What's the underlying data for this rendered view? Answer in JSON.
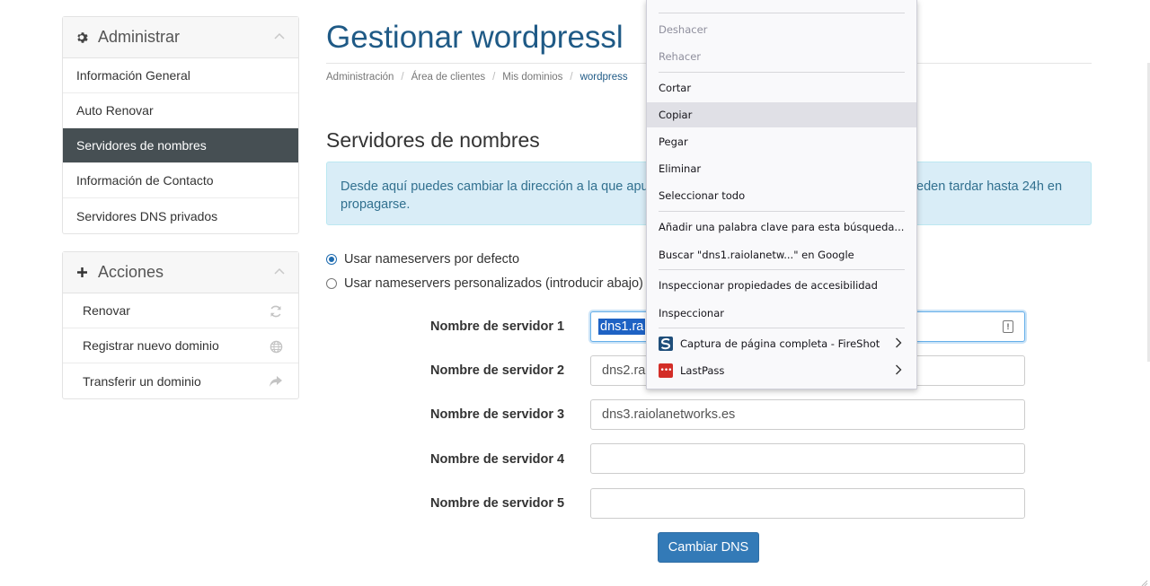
{
  "sidebar": {
    "admin_panel": {
      "title": "Administrar",
      "items": [
        {
          "label": "Información General"
        },
        {
          "label": "Auto Renovar"
        },
        {
          "label": "Servidores de nombres"
        },
        {
          "label": "Información de Contacto"
        },
        {
          "label": "Servidores DNS privados"
        }
      ]
    },
    "actions_panel": {
      "title": "Acciones",
      "items": [
        {
          "label": "Renovar",
          "icon": "refresh-icon"
        },
        {
          "label": "Registrar nuevo dominio",
          "icon": "globe-icon"
        },
        {
          "label": "Transferir un dominio",
          "icon": "share-arrow-icon"
        }
      ]
    }
  },
  "main": {
    "page_title": "Gestionar wordpressl",
    "breadcrumb": [
      "Administración",
      "Área de clientes",
      "Mis dominios",
      "wordpress"
    ],
    "section_title": "Servidores de nombres",
    "alert": {
      "left_text": "Desde aquí puedes cambiar la dirección a la que apu",
      "right_text": "eden tardar hasta 24h en",
      "second_line": "propagarse."
    },
    "radio_default": "Usar nameservers por defecto",
    "radio_custom": "Usar nameservers personalizados (introducir abajo)",
    "fields": [
      {
        "label": "Nombre de servidor 1",
        "value": "dns1.ra"
      },
      {
        "label": "Nombre de servidor 2",
        "value": "dns2.ra"
      },
      {
        "label": "Nombre de servidor 3",
        "value": "dns3.raiolanetworks.es"
      },
      {
        "label": "Nombre de servidor 4",
        "value": ""
      },
      {
        "label": "Nombre de servidor 5",
        "value": ""
      }
    ],
    "submit_label": "Cambiar DNS"
  },
  "context_menu": {
    "undo": "Deshacer",
    "redo": "Rehacer",
    "cut": "Cortar",
    "copy": "Copiar",
    "paste": "Pegar",
    "delete": "Eliminar",
    "select_all": "Seleccionar todo",
    "add_keyword": "Añadir una palabra clave para esta búsqueda...",
    "search_google": "Buscar \"dns1.raiolanetw...\" en Google",
    "inspect_accessibility": "Inspeccionar propiedades de accesibilidad",
    "inspect": "Inspeccionar",
    "fireshot": "Captura de página completa - FireShot",
    "lastpass": "LastPass"
  },
  "colors": {
    "title_blue": "#1f5a86",
    "active_nav": "#464f53",
    "alert_bg": "#d9edf7",
    "primary_button": "#337ab7"
  }
}
